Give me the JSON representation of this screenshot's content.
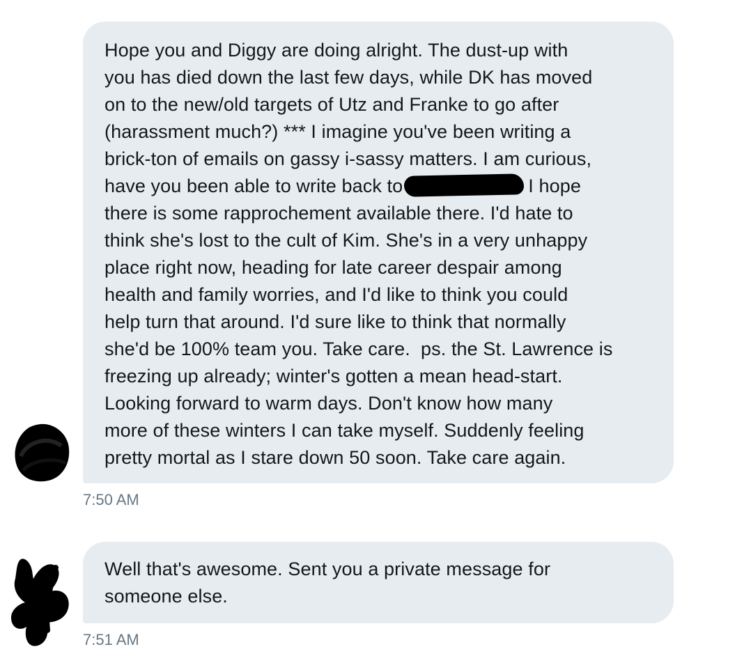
{
  "messages": [
    {
      "lines": [
        "Hope you and Diggy are doing alright. The dust-up with",
        "you has died down the last few days, while DK has moved",
        "on to the new/old targets of Utz and Franke to go after",
        "(harassment much?) *** I imagine you've been writing a",
        "brick-ton of emails on gassy i-sassy matters. I am curious,",
        "have you been able to write back to",
        "I hope",
        "there is some rapprochement available there. I'd hate to",
        "think she's lost to the cult of Kim. She's in a very unhappy",
        "place right now, heading for late career despair among",
        "health and family worries, and I'd like to think you could",
        "help turn that around. I'd sure like to think that normally",
        "she'd be 100% team you. Take care.  ps. the St. Lawrence is",
        "freezing up already; winter's gotten a mean head-start.",
        "Looking forward to warm days. Don't know how many",
        "more of these winters I can take myself. Suddenly feeling",
        "pretty mortal as I stare down 50 soon. Take care again."
      ],
      "time": "7:50 AM"
    },
    {
      "lines": [
        "Well that's awesome. Sent you a private message for",
        "someone else."
      ],
      "time": "7:51 AM"
    }
  ],
  "colors": {
    "bubble": "#e6ecf0",
    "text": "#14171a",
    "timestamp": "#657786",
    "redaction": "#000000"
  }
}
